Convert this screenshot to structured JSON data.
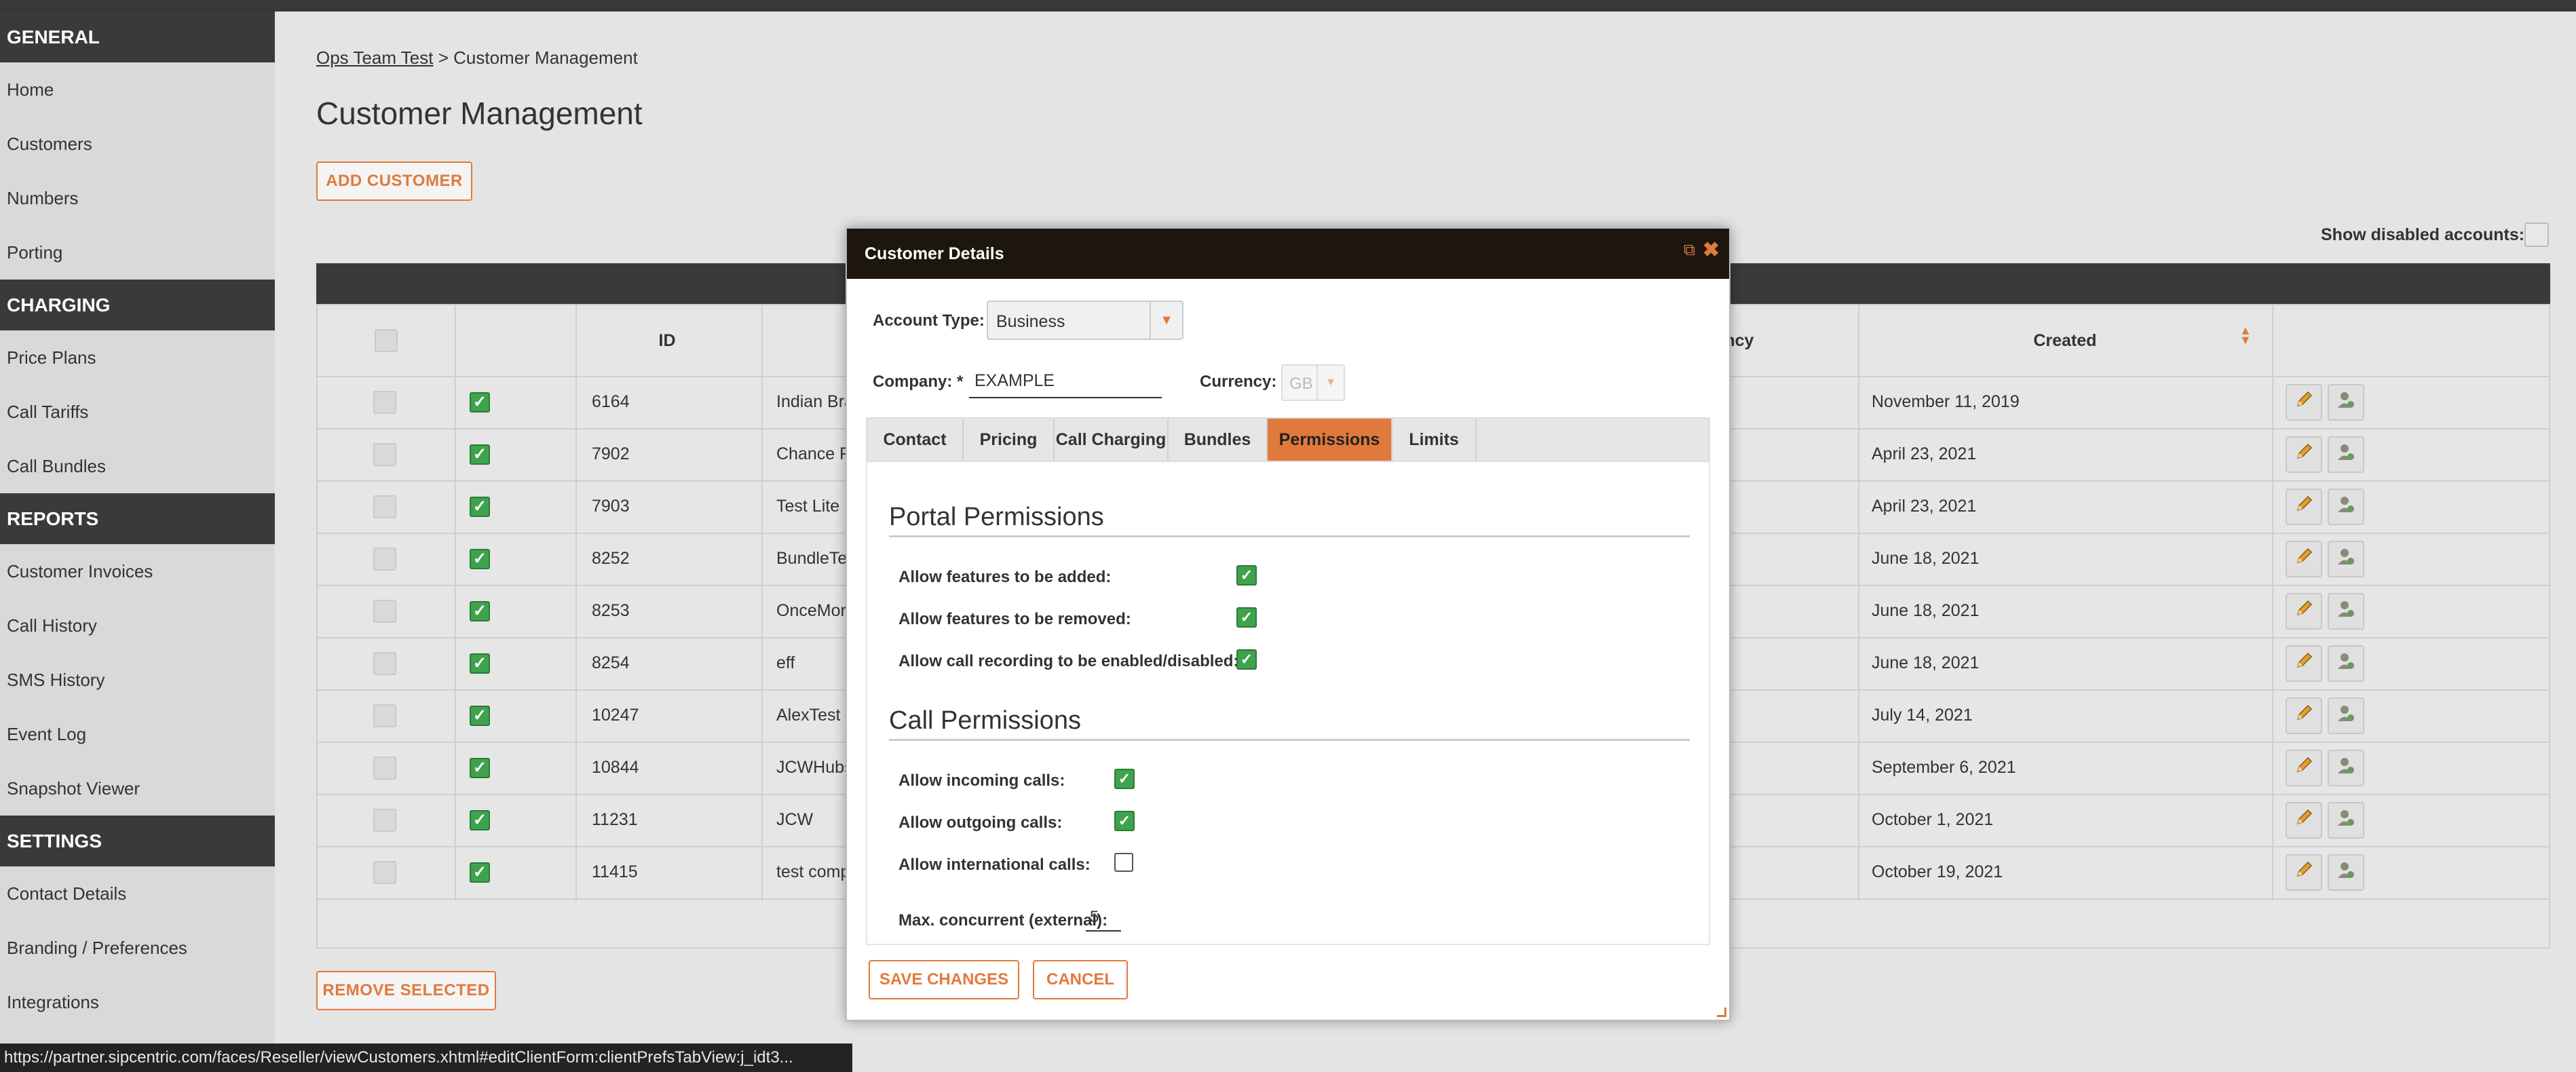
{
  "sidebar": {
    "sections": [
      {
        "title": "GENERAL",
        "items": [
          "Home",
          "Customers",
          "Numbers",
          "Porting"
        ]
      },
      {
        "title": "CHARGING",
        "items": [
          "Price Plans",
          "Call Tariffs",
          "Call Bundles"
        ]
      },
      {
        "title": "REPORTS",
        "items": [
          "Customer Invoices",
          "Call History",
          "SMS History",
          "Event Log",
          "Snapshot Viewer"
        ]
      },
      {
        "title": "SETTINGS",
        "items": [
          "Contact Details",
          "Branding / Preferences",
          "Integrations"
        ]
      }
    ]
  },
  "breadcrumb": {
    "parent": "Ops Team Test",
    "separator": ">",
    "current": "Customer Management"
  },
  "page_title": "Customer Management",
  "add_customer_label": "ADD CUSTOMER",
  "show_disabled_label": "Show disabled accounts:",
  "table": {
    "headers": {
      "id": "ID",
      "currency": "rrency",
      "created": "Created"
    },
    "rows": [
      {
        "id": "6164",
        "name": "Indian Bra",
        "created": "November 11, 2019"
      },
      {
        "id": "7902",
        "name": "Chance Fa",
        "created": "April 23, 2021"
      },
      {
        "id": "7903",
        "name": "Test Lite",
        "created": "April 23, 2021"
      },
      {
        "id": "8252",
        "name": "BundleTes",
        "created": "June 18, 2021"
      },
      {
        "id": "8253",
        "name": "OnceMore",
        "created": "June 18, 2021"
      },
      {
        "id": "8254",
        "name": "eff",
        "created": "June 18, 2021"
      },
      {
        "id": "10247",
        "name": "AlexTest",
        "created": "July 14, 2021"
      },
      {
        "id": "10844",
        "name": "JCWHubsp",
        "created": "September 6, 2021"
      },
      {
        "id": "11231",
        "name": "JCW",
        "created": "October 1, 2021"
      },
      {
        "id": "11415",
        "name": "test comp",
        "created": "October 19, 2021"
      }
    ]
  },
  "remove_selected_label": "REMOVE SELECTED",
  "status_url": "https://partner.sipcentric.com/faces/Reseller/viewCustomers.xhtml#editClientForm:clientPrefsTabView:j_idt3...",
  "dialog": {
    "title": "Customer Details",
    "account_type_label": "Account Type:",
    "account_type_value": "Business",
    "company_label": "Company: *",
    "company_value": "EXAMPLE",
    "currency_label": "Currency: *",
    "currency_value": "GB",
    "tabs": [
      "Contact",
      "Pricing",
      "Call Charging",
      "Bundles",
      "Permissions",
      "Limits"
    ],
    "active_tab": "Permissions",
    "portal_permissions": {
      "title": "Portal Permissions",
      "items": [
        {
          "label": "Allow features to be added:",
          "checked": true
        },
        {
          "label": "Allow features to be removed:",
          "checked": true
        },
        {
          "label": "Allow call recording to be enabled/disabled:",
          "checked": true
        }
      ]
    },
    "call_permissions": {
      "title": "Call Permissions",
      "items": [
        {
          "label": "Allow incoming calls:",
          "checked": true
        },
        {
          "label": "Allow outgoing calls:",
          "checked": true
        },
        {
          "label": "Allow international calls:",
          "checked": false
        }
      ],
      "max_concurrent_label": "Max. concurrent (external):",
      "max_concurrent_value": "5"
    },
    "save_label": "SAVE CHANGES",
    "cancel_label": "CANCEL"
  },
  "colors": {
    "accent": "#e07a3c",
    "dark": "#3a3a3a",
    "check_green": "#3fa34d"
  }
}
